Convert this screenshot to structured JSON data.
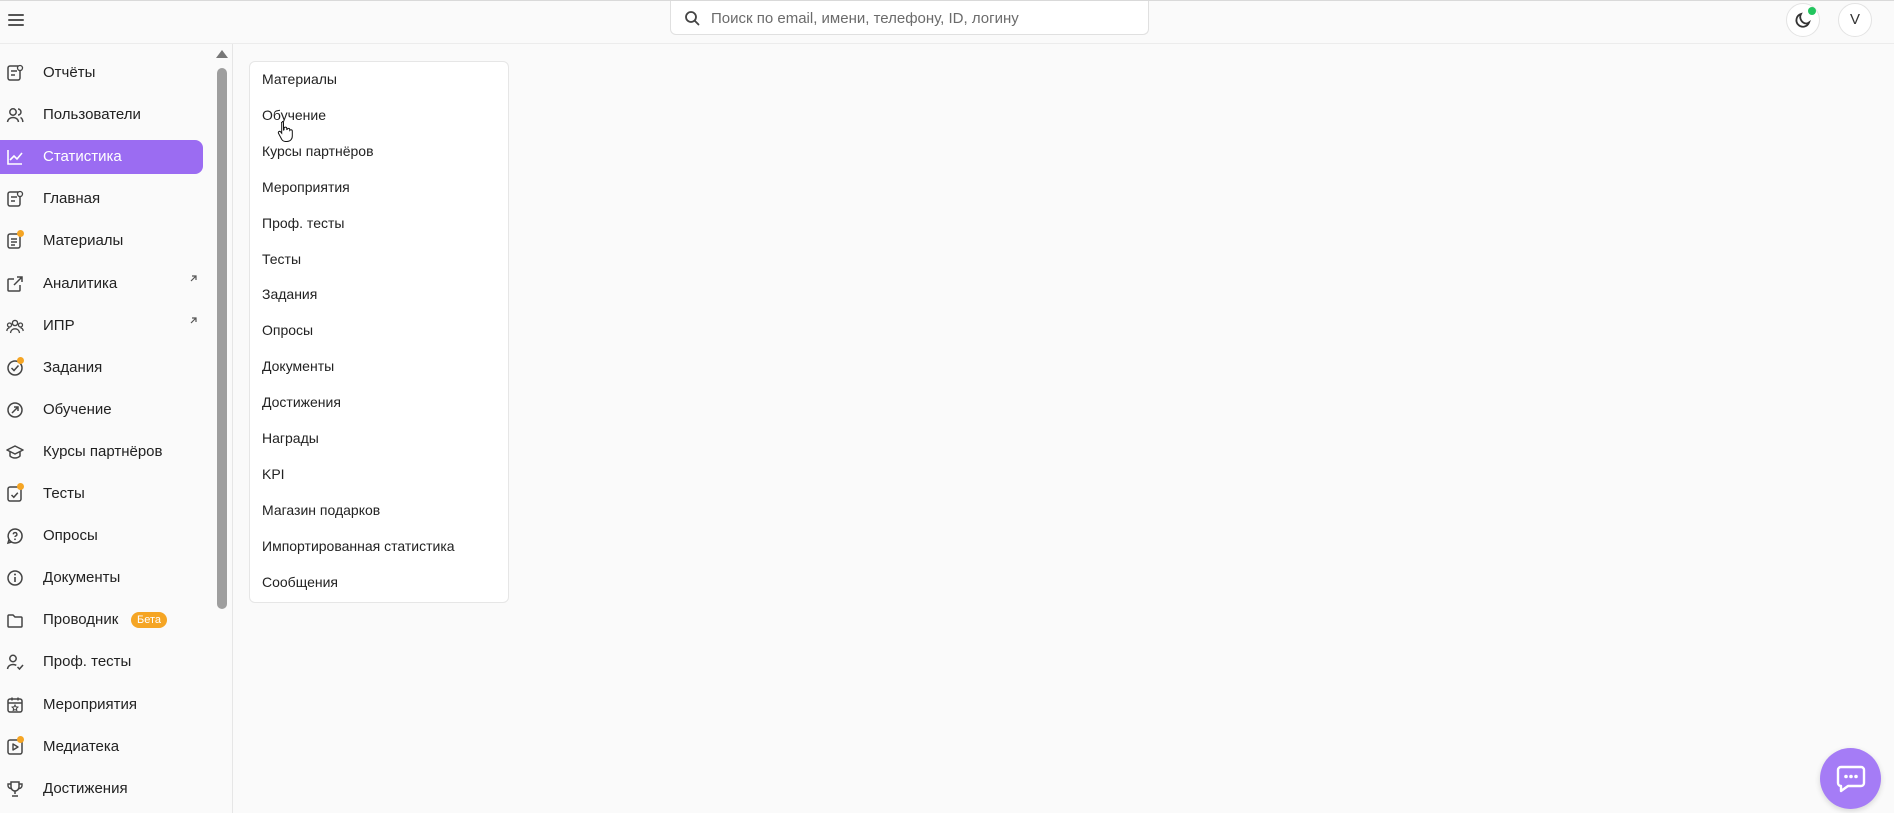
{
  "search": {
    "placeholder": "Поиск по email, имени, телефону, ID, логину"
  },
  "header": {
    "avatar_letter": "V"
  },
  "sidebar": {
    "items": [
      {
        "label": "Отчёты",
        "icon": "report-icon"
      },
      {
        "label": "Пользователи",
        "icon": "users-icon"
      },
      {
        "label": "Статистика",
        "icon": "chart-line-icon",
        "active": true
      },
      {
        "label": "Главная",
        "icon": "home-icon"
      },
      {
        "label": "Материалы",
        "icon": "materials-icon",
        "dot": true
      },
      {
        "label": "Аналитика",
        "icon": "external-link-icon",
        "external": true
      },
      {
        "label": "ИПР",
        "icon": "group-icon",
        "external": true
      },
      {
        "label": "Задания",
        "icon": "task-icon",
        "dot": true
      },
      {
        "label": "Обучение",
        "icon": "learning-icon"
      },
      {
        "label": "Курсы партнёров",
        "icon": "graduation-cap-icon"
      },
      {
        "label": "Тесты",
        "icon": "test-icon",
        "dot": true
      },
      {
        "label": "Опросы",
        "icon": "survey-icon"
      },
      {
        "label": "Документы",
        "icon": "info-icon"
      },
      {
        "label": "Проводник",
        "icon": "folder-icon",
        "badge": "Бета"
      },
      {
        "label": "Проф. тесты",
        "icon": "user-check-icon"
      },
      {
        "label": "Мероприятия",
        "icon": "calendar-icon"
      },
      {
        "label": "Медиатека",
        "icon": "media-icon",
        "dot": true
      },
      {
        "label": "Достижения",
        "icon": "trophy-icon"
      }
    ]
  },
  "stats_menu": {
    "items": [
      "Материалы",
      "Обучение",
      "Курсы партнёров",
      "Мероприятия",
      "Проф. тесты",
      "Тесты",
      "Задания",
      "Опросы",
      "Документы",
      "Достижения",
      "Награды",
      "KPI",
      "Магазин подарков",
      "Импортированная статистика",
      "Сообщения"
    ]
  },
  "colors": {
    "accent": "#9b6cf2",
    "badge": "#f5a524",
    "online": "#22c55e",
    "chat": "#a57cf6"
  }
}
